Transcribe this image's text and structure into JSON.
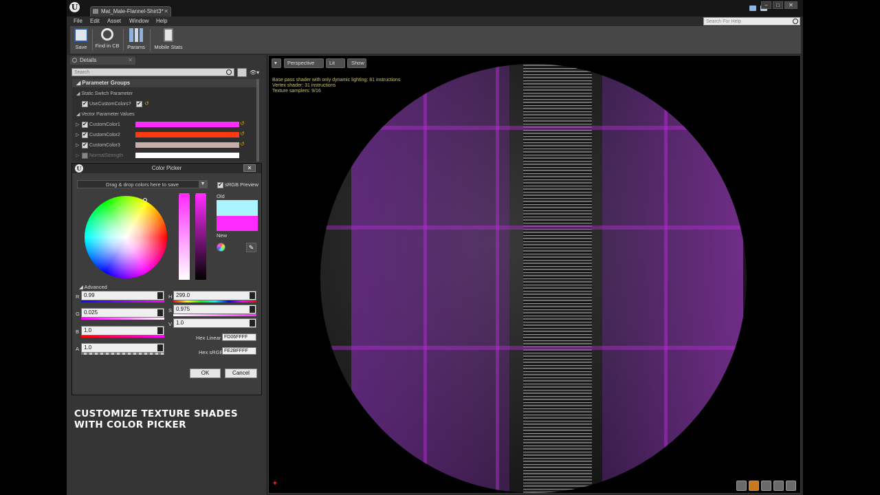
{
  "window": {
    "doc_tab": "Mat_Male-Flannel-Shirt3*",
    "search_help_placeholder": "Search For Help",
    "controls": {
      "minimize": "–",
      "maximize": "□",
      "close": "✕"
    }
  },
  "menu": [
    "File",
    "Edit",
    "Asset",
    "Window",
    "Help"
  ],
  "toolbar": {
    "buttons": [
      {
        "label": "Save",
        "icon": "save-icon"
      },
      {
        "label": "Find in CB",
        "icon": "magnifier-icon"
      },
      {
        "label": "Params",
        "icon": "params-icon"
      },
      {
        "label": "Mobile Stats",
        "icon": "mobile-stats-icon"
      }
    ]
  },
  "details": {
    "tab": "Details",
    "search_placeholder": "Search",
    "group": "Parameter Groups",
    "static_switch": "Static Switch Parameter",
    "use_custom_colors": "UseCustomColors?",
    "vector_params": "Vector Parameter Values",
    "params": [
      {
        "label": "CustomColor1",
        "color": "#ff2bff"
      },
      {
        "label": "CustomColor2",
        "color": "#ff3a12"
      },
      {
        "label": "CustomColor3",
        "color": "#c7aea8"
      },
      {
        "label": "NormalStrength",
        "color": "#ffffff"
      }
    ]
  },
  "caption": "CUSTOMIZE TEXTURE SHADES\nWITH COLOR PICKER",
  "color_picker": {
    "title": "Color Picker",
    "drop_text": "Drag & drop colors here to save",
    "srgb_label": "sRGB Preview",
    "old_label": "Old",
    "new_label": "New",
    "old_color": "#a9f5ff",
    "new_color": "#ff2bff",
    "advanced_label": "Advanced",
    "r_label": "R",
    "r_value": "0.99",
    "g_label": "G",
    "g_value": "0.025",
    "b_label": "B",
    "b_value": "1.0",
    "a_label": "A",
    "a_value": "1.0",
    "h_label": "H",
    "h_value": "299.0",
    "s_label": "S",
    "s_value": "0.975",
    "v_label": "V",
    "v_value": "1.0",
    "hex_linear_label": "Hex Linear",
    "hex_linear_value": "FD06FFFF",
    "hex_srgb_label": "Hex sRGB",
    "hex_srgb_value": "FE2BFFFF",
    "ok": "OK",
    "cancel": "Cancel"
  },
  "viewport": {
    "perspective": "Perspective",
    "lit": "Lit",
    "show": "Show",
    "stats": [
      "Base pass shader with only dynamic lighting: 81 instructions",
      "Vertex shader: 31 instructions",
      "Texture samplers: 9/16"
    ]
  }
}
